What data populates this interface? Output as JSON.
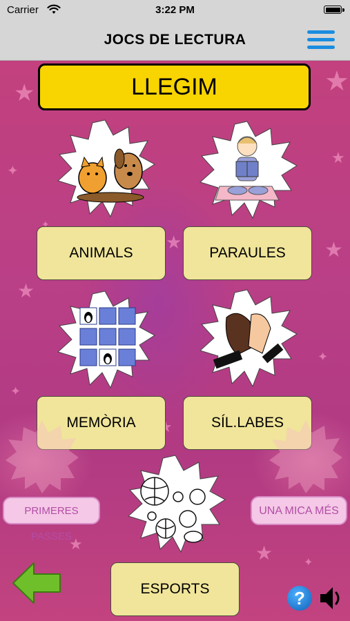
{
  "status_bar": {
    "carrier": "Carrier",
    "time": "3:22 PM"
  },
  "nav_bar": {
    "title": "JOCS DE LECTURA"
  },
  "header": {
    "label": "LLEGIM"
  },
  "games": [
    {
      "label": "ANIMALS",
      "icon": "cat-dog-icon"
    },
    {
      "label": "PARAULES",
      "icon": "girl-reading-icon"
    },
    {
      "label": "MEMÒRIA",
      "icon": "memory-cards-icon"
    },
    {
      "label": "SÍL.LABES",
      "icon": "clapping-hands-icon"
    },
    {
      "label": "ESPORTS",
      "icon": "sports-balls-icon"
    }
  ],
  "side_buttons": {
    "left": "PRIMERES PASSES",
    "right": "UNA MICA MÉS"
  },
  "colors": {
    "background": "#b93f86",
    "header_yellow": "#f8d400",
    "card_yellow": "#f0e59a",
    "menu_blue": "#1a8de0",
    "back_arrow_green": "#6fbf2a"
  }
}
